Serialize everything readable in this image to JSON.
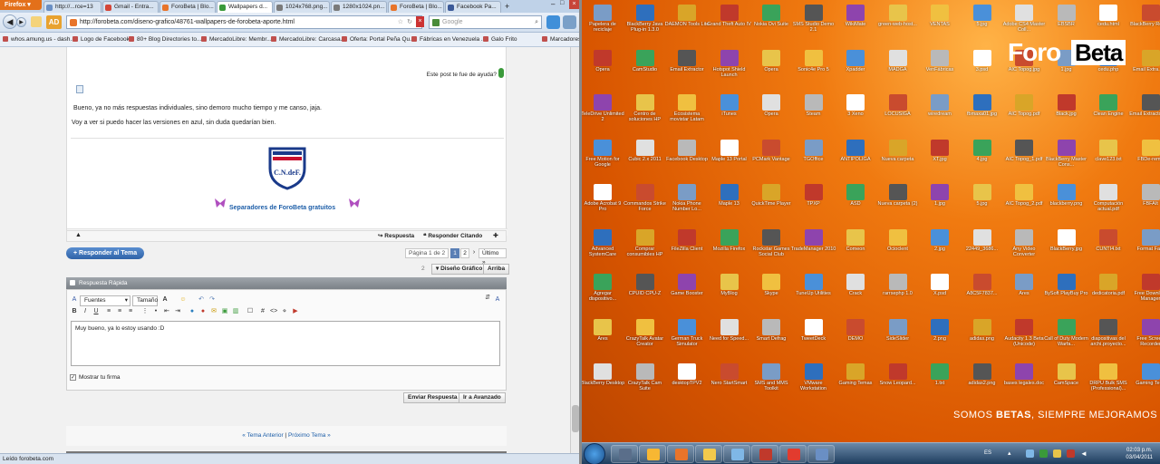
{
  "browser": {
    "menu_label": "Firefox",
    "tabs": [
      {
        "label": "http://...rce=13",
        "color": "#6a8fc4"
      },
      {
        "label": "Gmail - Entra...",
        "color": "#d44638"
      },
      {
        "label": "ForoBeta | Blo...",
        "color": "#e8742a"
      },
      {
        "label": "Wallpapers d...",
        "color": "#3a9a3a"
      },
      {
        "label": "1024x768.png...",
        "color": "#7a7a7a"
      },
      {
        "label": "1280x1024.pn...",
        "color": "#7a7a7a"
      },
      {
        "label": "ForoBeta | Blo...",
        "color": "#e8742a"
      },
      {
        "label": "Facebook Pa...",
        "color": "#3b5998"
      }
    ],
    "url": "http://forobeta.com/diseno-grafico/48761-wallpapers-de-forobeta-aporte.html",
    "search_placeholder": "Google",
    "bookmarks": [
      "whos.amung.us - dash...",
      "Logo de Facebook",
      "80+ Blog Directories to...",
      "MercadoLibre: Membr...",
      "MercadoLibre: Carcasa...",
      "Oferta: Portal Peña Qu...",
      "Fábricas en Venezuela ...",
      "Galo Frito",
      "Marcadores"
    ],
    "status_text": "Leído forobeta.com"
  },
  "post": {
    "help_question": "Este post te fue de ayuda?",
    "line1": "Bueno, ya no más respuestas individuales, sino demoro mucho tiempo y me canso, jaja.",
    "line2": "Voy a ver si puedo hacer las versiones en azul, sin duda quedarían bien.",
    "crest_text": "C.N.deF.",
    "separator_link": "Separadores de ForoBeta gratuitos",
    "reply_label": "Respuesta",
    "reply_quote_label": "Responder Citando"
  },
  "thread": {
    "respond_button": "+ Responder al Tema",
    "pagination_label": "Página 1 de 2",
    "pages": [
      "1",
      "2"
    ],
    "next_label": "›",
    "last_label": "Último »",
    "design_dropdown": "Diseño Gráfico",
    "top_button": "Arriba",
    "indicator": "2"
  },
  "quick_reply": {
    "title": "Respuesta Rápida",
    "font_select": "Fuentes",
    "size_select": "Tamaño",
    "message": "Muy bueno, ya lo estoy usando :D",
    "signature_label": "Mostrar tu firma",
    "send_button": "Enviar Respuesta",
    "advanced_button": "Ir a Avanzado"
  },
  "thread_nav": {
    "prev": "« Tema Anterior",
    "sep": "|",
    "next": "Próximo Tema »"
  },
  "desktop": {
    "logo_foro": "Foro",
    "logo_beta": "Beta",
    "slogan_a": "SOMOS ",
    "slogan_b": "BETAS",
    "slogan_c": ", SIEMPRE MEJORAMOS",
    "icons": [
      [
        "Papelera de reciclaje",
        "BlackBerry Java Plug-in 1.3.0",
        "DAEMON Tools Lite",
        "Grand Theft Auto IV",
        "Nokia Ovi Suite",
        "SMS Studio Demo 2.1",
        "WikiMate",
        "green-web-host...",
        "VENTAS",
        "5.jpg",
        "Adobe CS4 Master Coll...",
        "EBSBR",
        "cedu.html",
        "BlackBerry Report"
      ],
      [
        "Opera",
        "CamStudio",
        "Email Extractor",
        "Hotspot Shield Launch",
        "Opera",
        "Sonic4e Pro 5",
        "Xpadder",
        "MADGA",
        "VenFábricas",
        "3.psd",
        "AIC Topog.jpg",
        "1.jpg",
        "cedu.php",
        "Email Extra. 1.4"
      ],
      [
        "TeleDrive Unlimited 2",
        "Centro de soluciones HP",
        "Ecosistema movistar Latam",
        "iTunes",
        "Opera",
        "Steam",
        "3 Xeno",
        "LOCUSIGA",
        "wiredream",
        "fbmaxa01.jpg",
        "AIC Topog.pdf",
        "Black.jpg",
        "Clean Engine",
        "Email Extractor 1.4"
      ],
      [
        "Free Motion for Google",
        "Cubic 2.x 2011",
        "Facebook Desktop",
        "Maple 13 Portal",
        "PCMark Vantage",
        "TGOffice",
        "ANTIPOLIGA",
        "Nueva carpeta",
        "XT.jpg",
        "4.jpg",
        "AIC Topog_1.pdf",
        "BlackBerry Master Cons...",
        "clave123.txt",
        "FBDe-reme"
      ],
      [
        "Adobe Acrobat 9 Pro",
        "Commandos Strike Force",
        "Nokia Phone Number Lo...",
        "Maple 13",
        "QuickTime Player",
        "TPXP",
        "ASD",
        "Nueva carpeta (2)",
        "1.jpg",
        "5.jpg",
        "AIC Topog_2.pdf",
        "blackberry.png",
        "Computación actual.pdf",
        "FBFAIt"
      ],
      [
        "Advanced SystemCare",
        "Comprar consumibles HP",
        "FileZilla Client",
        "Mozilla Firefox",
        "Rockstar Games Social Club",
        "TradeManager 2010",
        "Comeon",
        "Ocioclent",
        "2.jpg",
        "22449_3686...",
        "Any Video Converter",
        "BlackBerry.jpg",
        "CUNTI4.txt",
        "Format Fac."
      ],
      [
        "Agregar dispositivo...",
        "CPUID CPU-Z",
        "Game Booster",
        "MyBlog",
        "Skype",
        "TuneUp Utilities",
        "Crack",
        "rarrsephp 1.0",
        "X.psd",
        "A8C5F7837...",
        "Ares",
        "BySoft PlayBuy Pro",
        "dedicatoria.pdf",
        "Free Downloa. Manager"
      ],
      [
        "Ares",
        "CrazyTalk Avatar Creator",
        "German Truck Simulator",
        "Need for Speed...",
        "Smart Defrag",
        "TweetDeck",
        "DEMO",
        "SideSlider",
        "2.png",
        "adidas.png",
        "Audacity 1.3 Beta (Unicode)",
        "Call of Duty Modern Warfa...",
        "diapositivas del archi.proyecto...",
        "Free Screen Recorder"
      ],
      [
        "BlackBerry Desktop",
        "CrazyTalk Cam Suite",
        "desktopTPV2",
        "Nero StartSmart",
        "SMS and MMS Toolkit",
        "VMware Workstation",
        "Gaming Temas",
        "Snow Leopard...",
        "1.txt",
        "adidas2.png",
        "bases legales.doc",
        "CamSpace",
        "DRPU Bulk SMS (Professional)...",
        "Gaming Tem."
      ]
    ],
    "icon_colors": [
      "#7a9cc6",
      "#2e6fbd",
      "#d9a528",
      "#c0392b",
      "#3aa35a",
      "#555",
      "#8e44ad",
      "#e8c44a",
      "#f0c040",
      "#4a90d9",
      "#e0e0e0",
      "#b9b9b9",
      "#ffffff",
      "#c94b2e"
    ],
    "taskbar_clock_time": "02:03 p.m.",
    "taskbar_clock_date": "03/04/2011",
    "taskbar_lang": "ES",
    "taskbar_colors": [
      "#5a6e8a",
      "#f7b733",
      "#e8742a",
      "#f2c94c",
      "#7fb7e6",
      "#c0392b",
      "#e23b2e",
      "#6a8fc4"
    ]
  }
}
